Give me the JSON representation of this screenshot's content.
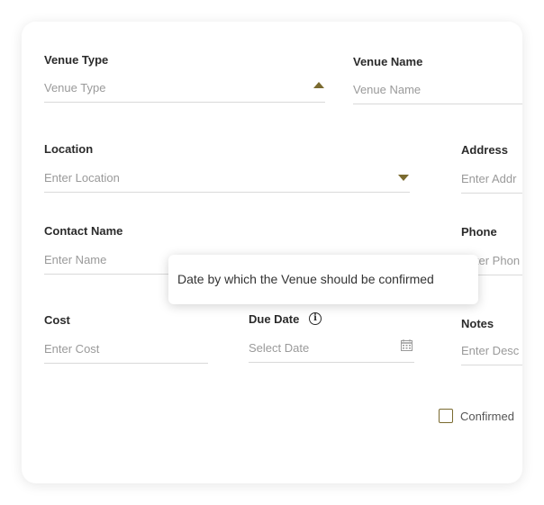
{
  "form": {
    "venue_type": {
      "label": "Venue Type",
      "placeholder": "Venue Type"
    },
    "venue_name": {
      "label": "Venue Name",
      "placeholder": "Venue Name"
    },
    "location": {
      "label": "Location",
      "placeholder": "Enter Location"
    },
    "address": {
      "label": "Address",
      "placeholder": "Enter Addr"
    },
    "contact_name": {
      "label": "Contact Name",
      "placeholder": "Enter Name"
    },
    "phone": {
      "label": "Phone",
      "placeholder": "Enter Phon"
    },
    "cost": {
      "label": "Cost",
      "placeholder": "Enter Cost"
    },
    "due_date": {
      "label": "Due Date",
      "placeholder": "Select Date",
      "info_icon": "info-icon"
    },
    "notes": {
      "label": "Notes",
      "placeholder": "Enter Desc"
    },
    "confirmed": {
      "label": "Confirmed",
      "checked": false
    }
  },
  "tooltip": {
    "text": "Date by which the Venue should be confirmed"
  },
  "colors": {
    "accent": "#7a6a2f",
    "underline": "#d9d9d9",
    "placeholder": "#9a9a9a"
  }
}
